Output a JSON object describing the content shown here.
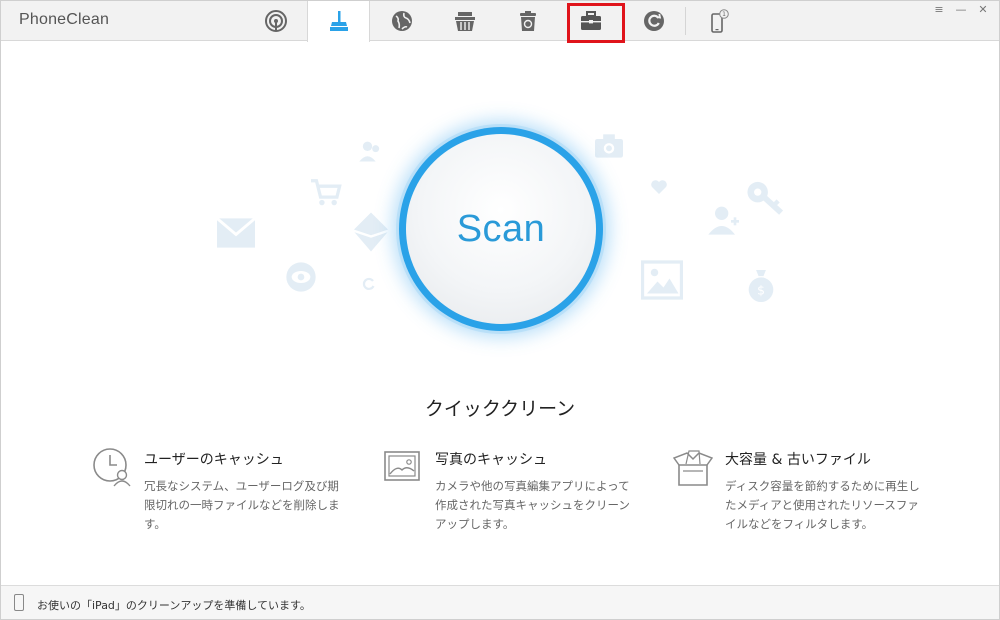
{
  "app": {
    "title": "PhoneClean"
  },
  "toolbar": {
    "buttons": [
      {
        "icon": "fingerprint-icon",
        "label": ""
      },
      {
        "icon": "broom-icon",
        "active": true
      },
      {
        "icon": "globe-icon"
      },
      {
        "icon": "basket-icon"
      },
      {
        "icon": "trash-icon"
      },
      {
        "icon": "toolbox-icon"
      },
      {
        "icon": "refresh-icon"
      },
      {
        "icon": "phone-icon",
        "badge": "1"
      }
    ],
    "accent": "#2aa2e8",
    "highlight_color": "#e0141b"
  },
  "window_controls": {
    "menu": "≡",
    "minimize": "—",
    "close": "✕"
  },
  "scan": {
    "label": "Scan"
  },
  "mode": {
    "title": "クイッククリーン"
  },
  "features": [
    {
      "icon": "clock-user-icon",
      "title": "ユーザーのキャッシュ",
      "desc": "冗長なシステム、ユーザーログ及び期限切れの一時ファイルなどを削除します。"
    },
    {
      "icon": "photo-icon",
      "title": "写真のキャッシュ",
      "desc": "カメラや他の写真編集アプリによって作成された写真キャッシュをクリーンアップします。"
    },
    {
      "icon": "open-box-icon",
      "title": "大容量 & 古いファイル",
      "desc": "ディスク容量を節約するために再生したメディアと使用されたリソースファイルなどをフィルタします。"
    }
  ],
  "status": {
    "text": "お使いの「iPad」のクリーンアップを準備しています。"
  }
}
